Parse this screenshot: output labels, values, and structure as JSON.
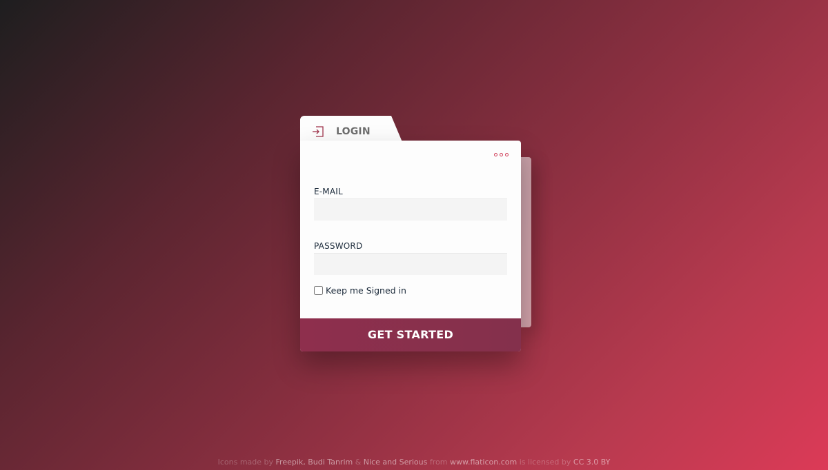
{
  "login_tab": {
    "label": "LOGIN",
    "icon": "login-icon"
  },
  "card": {
    "more_icon": "more-options-icon",
    "email_label": "E-MAIL",
    "email_value": "",
    "password_label": "PASSWORD",
    "password_value": "",
    "keep_signed_in_label": "Keep me Signed in",
    "keep_signed_in_checked": false,
    "submit_label": "GET STARTED"
  },
  "footer": {
    "prefix": "Icons made by",
    "author1": "Freepik, Budi Tanrim",
    "amp": "&",
    "author2": "Nice and Serious",
    "from": "from",
    "site": "www.flaticon.com",
    "licensed": "is licensed by",
    "license": "CC 3.0 BY"
  },
  "colors": {
    "accent": "#d0405a",
    "button": "#8a2f4c",
    "tab_text": "#6e6e6e"
  }
}
